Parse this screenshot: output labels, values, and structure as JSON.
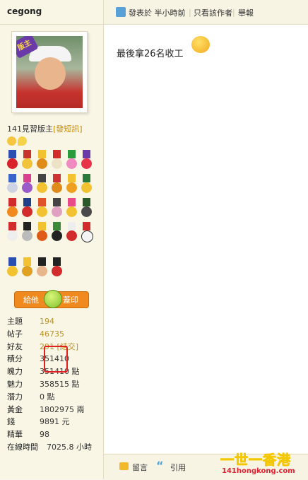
{
  "user": {
    "name": "cegong",
    "avatar_badge": "版主",
    "role": "141見習版主",
    "pm_label": "[發短訊]"
  },
  "stamp": {
    "give_label": "給他",
    "stamp_label": "蓋印"
  },
  "stats": [
    {
      "label": "主題",
      "value": "194"
    },
    {
      "label": "帖子",
      "value": "46735"
    },
    {
      "label": "好友",
      "value": "291 [結交]"
    },
    {
      "label": "積分",
      "value": "351410"
    },
    {
      "label": "魄力",
      "value": "351410 點"
    },
    {
      "label": "魅力",
      "value": "358515 點"
    },
    {
      "label": "潛力",
      "value": "0 點"
    },
    {
      "label": "黃金",
      "value": "1802975 兩"
    },
    {
      "label": "錢",
      "value": "9891 元"
    },
    {
      "label": "精華",
      "value": "98"
    },
    {
      "label": "在線時間",
      "value": "7025.8 小時"
    }
  ],
  "post": {
    "posted_label": "發表於 半小時前",
    "only_author_label": "只看該作者",
    "report_label": "舉報",
    "content": "最後拿26名收工",
    "emoji": "happy-face-icon"
  },
  "footer": {
    "reply_label": "留言",
    "quote_label": "引用"
  },
  "watermark": {
    "line1": "一世一香港",
    "line2": "141hongkong.com"
  }
}
